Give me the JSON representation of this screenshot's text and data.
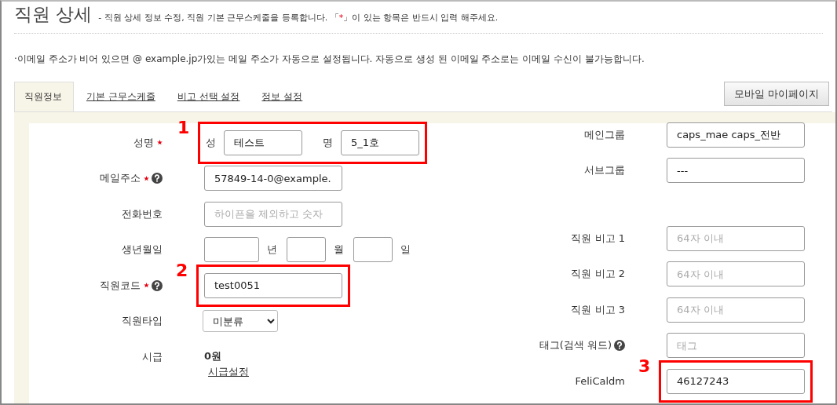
{
  "page": {
    "title": "직원 상세",
    "description_parts": [
      {
        "kind": "plain",
        "text": "- 직원 상세 정보 수정, 직원 기본 근무스케줄을 등록합니다. 「"
      },
      {
        "kind": "required",
        "text": "*"
      },
      {
        "kind": "plain",
        "text": "」이 있는 항목은 반드시 입력 해주세요."
      }
    ]
  },
  "notice": "·이메일 주소가 비어 있으면 @ example.jp가있는 메일 주소가 자동으로 설정됩니다. 자동으로 생성 된 이메일 주소로는 이메일 수신이 불가능합니다.",
  "tabs": [
    {
      "label": "직원정보",
      "selected": true
    },
    {
      "label": "기본 근무스케줄",
      "selected": false
    },
    {
      "label": "비고 선택 설정",
      "selected": false
    },
    {
      "label": "정보 설정",
      "selected": false
    }
  ],
  "mobile_button": "모바일 마이페이지",
  "left_fields": [
    {
      "kind": "name",
      "label": "성명",
      "required": true,
      "help": false,
      "annotation": "1",
      "parts": [
        {
          "label": "성",
          "value": "테스트"
        },
        {
          "label": "명",
          "value": "5_1호"
        }
      ]
    },
    {
      "kind": "text",
      "label": "메일주소",
      "required": true,
      "help": true,
      "value": "57849-14-0@example."
    },
    {
      "kind": "text",
      "label": "전화번호",
      "required": false,
      "help": false,
      "placeholder": "하이픈을 제외하고 숫자"
    },
    {
      "kind": "date",
      "label": "생년월일",
      "required": false,
      "help": false,
      "parts": [
        {
          "unit": "년"
        },
        {
          "unit": "월"
        },
        {
          "unit": "일"
        }
      ]
    },
    {
      "kind": "text",
      "label": "직원코드",
      "required": true,
      "help": true,
      "annotation": "2",
      "value": "test0051"
    },
    {
      "kind": "select",
      "label": "직원타입",
      "required": false,
      "help": false,
      "value": "미분류"
    },
    {
      "kind": "amount",
      "label": "시급",
      "required": false,
      "help": false,
      "value": "0원",
      "link": "시급설정"
    }
  ],
  "right_fields": [
    {
      "kind": "text",
      "label": "메인그룹",
      "help": false,
      "value": "caps_mae caps_전반"
    },
    {
      "kind": "text",
      "label": "서브그룹",
      "help": false,
      "value": "---"
    },
    {
      "kind": "spacer"
    },
    {
      "kind": "text",
      "label": "직원 비고 1",
      "help": false,
      "placeholder": "64자 이내"
    },
    {
      "kind": "text",
      "label": "직원 비고 2",
      "help": false,
      "placeholder": "64자 이내"
    },
    {
      "kind": "text",
      "label": "직원 비고 3",
      "help": false,
      "placeholder": "64자 이내"
    },
    {
      "kind": "text",
      "label": "태그(검색 워드)",
      "help": true,
      "placeholder": "태그"
    },
    {
      "kind": "text",
      "label": "FeliCaldm",
      "help": false,
      "annotation": "3",
      "value": "46127243"
    }
  ]
}
